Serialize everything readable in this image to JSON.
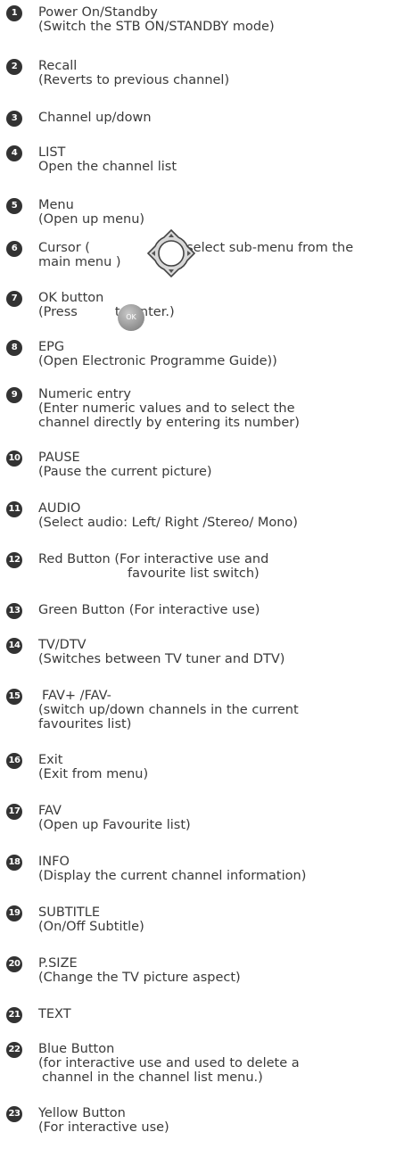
{
  "items": [
    {
      "num": "1",
      "lines": [
        "Power On/Standby",
        "(Switch the STB ON/STANDBY mode)"
      ]
    },
    {
      "num": "2",
      "lines": [
        "Recall",
        "(Reverts to previous channel)"
      ]
    },
    {
      "num": "3",
      "lines": [
        "Channel up/down"
      ]
    },
    {
      "num": "4",
      "lines": [
        "LIST",
        "Open the channel list"
      ]
    },
    {
      "num": "5",
      "lines": [
        "Menu",
        "(Open up menu)"
      ]
    },
    {
      "num": "6",
      "lines": [
        "Cursor (",
        "to select sub-menu from the",
        "main menu )"
      ]
    },
    {
      "num": "7",
      "lines": [
        "OK button",
        "(Press",
        "to enter.)"
      ],
      "ok_label": "OK"
    },
    {
      "num": "8",
      "lines": [
        "EPG",
        "(Open Electronic Programme Guide))"
      ]
    },
    {
      "num": "9",
      "lines": [
        "Numeric entry",
        "(Enter numeric values and to select the",
        "channel directly by entering its number)"
      ]
    },
    {
      "num": "10",
      "lines": [
        "PAUSE",
        "(Pause the current picture)"
      ]
    },
    {
      "num": "11",
      "lines": [
        "AUDIO",
        "(Select audio: Left/ Right /Stereo/ Mono)"
      ]
    },
    {
      "num": "12",
      "lines": [
        "Red Button (For interactive use and",
        "favourite list switch)"
      ]
    },
    {
      "num": "13",
      "lines": [
        "Green Button (For interactive use)"
      ]
    },
    {
      "num": "14",
      "lines": [
        "TV/DTV",
        "(Switches between TV tuner and DTV)"
      ]
    },
    {
      "num": "15",
      "lines": [
        "FAV+ /FAV-",
        "(switch up/down channels in the current",
        "favourites list)"
      ]
    },
    {
      "num": "16",
      "lines": [
        "Exit",
        "(Exit from menu)"
      ]
    },
    {
      "num": "17",
      "lines": [
        "FAV",
        "(Open up Favourite list)"
      ]
    },
    {
      "num": "18",
      "lines": [
        "INFO",
        "(Display the current channel information)"
      ]
    },
    {
      "num": "19",
      "lines": [
        "SUBTITLE",
        "(On/Off Subtitle)"
      ]
    },
    {
      "num": "20",
      "lines": [
        "P.SIZE",
        "(Change the TV picture aspect)"
      ]
    },
    {
      "num": "21",
      "lines": [
        "TEXT"
      ]
    },
    {
      "num": "22",
      "lines": [
        "Blue Button",
        "(for interactive use and used to delete a",
        "channel in the channel list menu.)"
      ]
    },
    {
      "num": "23",
      "lines": [
        "Yellow Button",
        "(For interactive use)"
      ]
    }
  ]
}
